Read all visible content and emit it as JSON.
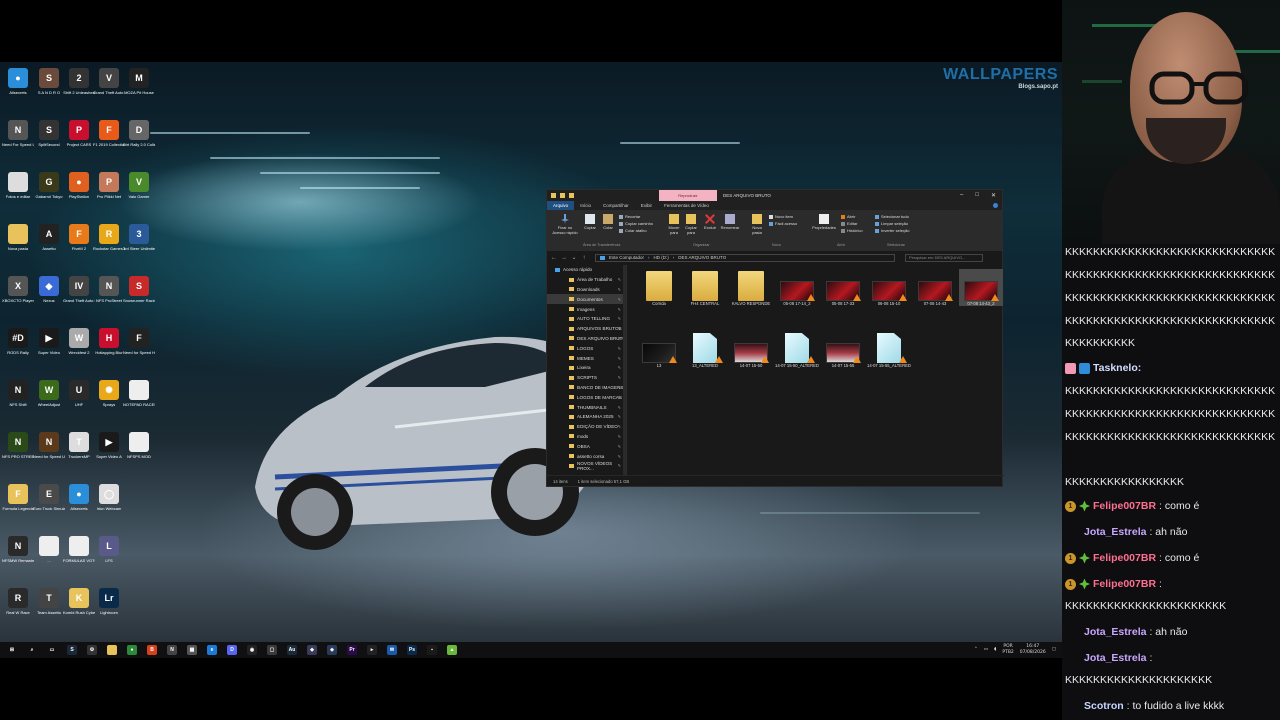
{
  "wallpaper": {
    "brand": "WALLPAPERS",
    "brand_sub": "Blogs.sapo.pt"
  },
  "desktop_icons": [
    {
      "label": "Allsecrets",
      "color": "#2a8fd8",
      "glyph": "●"
    },
    {
      "label": "S A N D R O",
      "color": "#6a4a3a",
      "glyph": "S"
    },
    {
      "label": "Shift 2 Unleashed",
      "color": "#333",
      "glyph": "2"
    },
    {
      "label": "Grand Theft Auto V",
      "color": "#444",
      "glyph": "V"
    },
    {
      "label": "MOZA Pit House",
      "color": "#222",
      "glyph": "M"
    },
    {
      "label": "Need For Speed Unb...",
      "color": "#555",
      "glyph": "N"
    },
    {
      "label": "SplitSecond",
      "color": "#333",
      "glyph": "S"
    },
    {
      "label": "Project CARS",
      "color": "#c8102e",
      "glyph": "P"
    },
    {
      "label": "F1 2019 Collection",
      "color": "#e85a1a",
      "glyph": "F"
    },
    {
      "label": "Dirt Rally 2.0 Collected",
      "color": "#666",
      "glyph": "D"
    },
    {
      "label": "Fotos e editar",
      "color": "#ddd",
      "glyph": ""
    },
    {
      "label": "Gabarrol Tokyo",
      "color": "#3a3a1a",
      "glyph": "G"
    },
    {
      "label": "PlayStation",
      "color": "#e06020",
      "glyph": "●"
    },
    {
      "label": "Pro Pilkki Net",
      "color": "#c47a5a",
      "glyph": "P"
    },
    {
      "label": "Valo Gamer",
      "color": "#4a8a2a",
      "glyph": "V"
    },
    {
      "label": "Nova pasta",
      "color": "#e8c25a",
      "glyph": ""
    },
    {
      "label": "Assetto",
      "color": "#222",
      "glyph": "A"
    },
    {
      "label": "FiveM 2",
      "color": "#e87a1a",
      "glyph": "F"
    },
    {
      "label": "Rockstar Games L...",
      "color": "#e8a81a",
      "glyph": "R"
    },
    {
      "label": "3rd Steer Unlimited 2",
      "color": "#2a5a9a",
      "glyph": "3"
    },
    {
      "label": "XBOXCTO Player",
      "color": "#555",
      "glyph": "X"
    },
    {
      "label": "Nexus",
      "color": "#3a6ad6",
      "glyph": "◆"
    },
    {
      "label": "Grand Theft Auto IV",
      "color": "#444",
      "glyph": "IV"
    },
    {
      "label": "NFS ProStreet",
      "color": "#555",
      "glyph": "N"
    },
    {
      "label": "Snowrunner Racing",
      "color": "#c82a2a",
      "glyph": "S"
    },
    {
      "label": "RODS Rally",
      "color": "#1a1a1a",
      "glyph": "#D"
    },
    {
      "label": "Super Video",
      "color": "#1a1a1a",
      "glyph": "▶"
    },
    {
      "label": "Wreckfest 2",
      "color": "#aaa",
      "glyph": "W"
    },
    {
      "label": "Hotlapping Blur",
      "color": "#c8102e",
      "glyph": "H"
    },
    {
      "label": "Need for Speed Heat",
      "color": "#222",
      "glyph": "F"
    },
    {
      "label": "NFS Shift",
      "color": "#222",
      "glyph": "N"
    },
    {
      "label": "WheelAdjust",
      "color": "#3a6a1a",
      "glyph": "W"
    },
    {
      "label": "UHF",
      "color": "#2a2a2a",
      "glyph": "U"
    },
    {
      "label": "Sprays",
      "color": "#e8a81a",
      "glyph": "✺"
    },
    {
      "label": "NOTEPAD RACES",
      "color": "#eee",
      "glyph": ""
    },
    {
      "label": "NFS PRO STREET",
      "color": "#2a4a1a",
      "glyph": "N"
    },
    {
      "label": "Need for Speed Underground",
      "color": "#5a3a1a",
      "glyph": "N"
    },
    {
      "label": "TruckersMP",
      "color": "#ddd",
      "glyph": "T"
    },
    {
      "label": "Super Video A",
      "color": "#1a1a1a",
      "glyph": "▶"
    },
    {
      "label": "NFSPS MOD",
      "color": "#eee",
      "glyph": ""
    },
    {
      "label": "Formula Legends",
      "color": "#e8c25a",
      "glyph": "F"
    },
    {
      "label": "Euro Truck Simulator 2",
      "color": "#4a4a4a",
      "glyph": "E"
    },
    {
      "label": "Allsecrets",
      "color": "#2a8fd8",
      "glyph": "●"
    },
    {
      "label": "Iriun Webcam",
      "color": "#ddd",
      "glyph": "◯"
    },
    {
      "label": "",
      "color": "#000",
      "glyph": ""
    },
    {
      "label": "NFSMW Remaster",
      "color": "#2a2a2a",
      "glyph": "N"
    },
    {
      "label": "...",
      "color": "#eee",
      "glyph": ""
    },
    {
      "label": "FORMULAS VOTOS LIVE",
      "color": "#eee",
      "glyph": ""
    },
    {
      "label": "LFS",
      "color": "#5a5a8a",
      "glyph": "L"
    },
    {
      "label": "",
      "color": "#000",
      "glyph": ""
    },
    {
      "label": "Real W Race",
      "color": "#2a2a2a",
      "glyph": "R"
    },
    {
      "label": "Team Assetto",
      "color": "#444",
      "glyph": "T"
    },
    {
      "label": "Kombi Rush Cyberfunk",
      "color": "#e8c25a",
      "glyph": "K"
    },
    {
      "label": "Lightroom",
      "color": "#0a2a4a",
      "glyph": "Lr"
    }
  ],
  "explorer": {
    "title": "DES ARQUIVO BRUTO",
    "context_tab": "Reproduzir",
    "tabs": [
      "Arquivo",
      "Início",
      "Compartilhar",
      "Exibir",
      "Ferramentas de Vídeo"
    ],
    "ribbon": {
      "pin": "Fixar no Acesso rápido",
      "copy": "Copiar",
      "paste": "Colar",
      "cut": "Recortar",
      "copy_path": "Copiar caminho",
      "paste_shortcut": "Colar atalho",
      "move_to": "Mover para",
      "copy_to": "Copiar para",
      "delete": "Excluir",
      "rename": "Renomear",
      "new_folder": "Nova pasta",
      "new_item": "Novo item",
      "easy_access": "Fácil acesso",
      "properties": "Propriedades",
      "open": "Abrir",
      "edit": "Editar",
      "history": "Histórico",
      "select_all": "Selecionar tudo",
      "select_none": "Limpar seleção",
      "invert": "Inverter seleção",
      "grp_clipboard": "Área de Transferência",
      "grp_organize": "Organizar",
      "grp_new": "Novo",
      "grp_open": "Abrir",
      "grp_select": "Selecionar"
    },
    "address": [
      "Este Computador",
      "HD (D:)",
      "DES ARQUIVO BRUTO"
    ],
    "search_placeholder": "Pesquisar em DES ARQUIVO...",
    "nav_items": [
      {
        "label": "Acesso rápido",
        "head": true
      },
      {
        "label": "Área de Trabalho"
      },
      {
        "label": "Downloads"
      },
      {
        "label": "Documentos",
        "selected": true
      },
      {
        "label": "Imagens"
      },
      {
        "label": "AUTO TELLING"
      },
      {
        "label": "ARQUIVOS BRUTOS"
      },
      {
        "label": "DES ARQUIVO BRUTO"
      },
      {
        "label": "LOGOS"
      },
      {
        "label": "MEMES"
      },
      {
        "label": "Lixeira"
      },
      {
        "label": "SCRIPTS"
      },
      {
        "label": "BANCO DE IMAGENS"
      },
      {
        "label": "LOGOS DE MARCAS"
      },
      {
        "label": "THUMBNAILS"
      },
      {
        "label": "ALEMANHA 2025"
      },
      {
        "label": "EDIÇÃO DE VÍDEO"
      },
      {
        "label": "mods"
      },
      {
        "label": "OBSA"
      },
      {
        "label": "assetto corsa"
      },
      {
        "label": "NOVOS VÍDEOS PROX..."
      }
    ],
    "files": [
      {
        "name": "Corrida",
        "kind": "folder"
      },
      {
        "name": "FH4 CENTRAL",
        "kind": "folder"
      },
      {
        "name": "KALVO RESPONDE",
        "kind": "folder"
      },
      {
        "name": "05-08 17-14_2",
        "kind": "vid"
      },
      {
        "name": "05-08 17-33",
        "kind": "vid"
      },
      {
        "name": "06-08 15-10",
        "kind": "vid"
      },
      {
        "name": "07-08 14-43",
        "kind": "vid"
      },
      {
        "name": "07-08 14-43_2",
        "kind": "vid",
        "selected": true
      },
      {
        "name": "13",
        "kind": "dark"
      },
      {
        "name": "13_ALTERED",
        "kind": "doc"
      },
      {
        "name": "14-07 15-50",
        "kind": "car"
      },
      {
        "name": "14-07 15-50_ALTERED",
        "kind": "doc"
      },
      {
        "name": "14-07 15-55",
        "kind": "car"
      },
      {
        "name": "14-07 15-55_ALTERED",
        "kind": "doc"
      }
    ],
    "status": {
      "count": "14 itens",
      "selection": "1 item selecionado  57,1 GB"
    }
  },
  "taskbar": {
    "apps": [
      {
        "name": "windows",
        "glyph": "⊞",
        "color": "#101012"
      },
      {
        "name": "search",
        "glyph": "⌕",
        "color": "#101012"
      },
      {
        "name": "task-view",
        "glyph": "▭",
        "color": "#101012"
      },
      {
        "name": "steam",
        "glyph": "S",
        "color": "#1b2838"
      },
      {
        "name": "settings",
        "glyph": "⚙",
        "color": "#333"
      },
      {
        "name": "explorer",
        "glyph": "",
        "color": "#e8c25a"
      },
      {
        "name": "chrome",
        "glyph": "●",
        "color": "#2a8a3a"
      },
      {
        "name": "brave",
        "glyph": "B",
        "color": "#d6401a"
      },
      {
        "name": "notepad",
        "glyph": "N",
        "color": "#444"
      },
      {
        "name": "calculator",
        "glyph": "▦",
        "color": "#555"
      },
      {
        "name": "edge",
        "glyph": "e",
        "color": "#1a7ad6"
      },
      {
        "name": "discord",
        "glyph": "D",
        "color": "#5865f2"
      },
      {
        "name": "obs",
        "glyph": "◉",
        "color": "#222"
      },
      {
        "name": "files",
        "glyph": "▢",
        "color": "#3a3a3a"
      },
      {
        "name": "audition",
        "glyph": "Au",
        "color": "#1a2a3a"
      },
      {
        "name": "app",
        "glyph": "◆",
        "color": "#3a3a5a"
      },
      {
        "name": "vpn",
        "glyph": "◈",
        "color": "#2a3a5a"
      },
      {
        "name": "premiere",
        "glyph": "Pr",
        "color": "#2a0a4a"
      },
      {
        "name": "gamebar",
        "glyph": "▸",
        "color": "#222"
      },
      {
        "name": "mail",
        "glyph": "✉",
        "color": "#1a5aaa"
      },
      {
        "name": "photoshop",
        "glyph": "Ps",
        "color": "#0a2a4a"
      },
      {
        "name": "app2",
        "glyph": "▪",
        "color": "#1a1a1a"
      },
      {
        "name": "android",
        "glyph": "▲",
        "color": "#6ab83a"
      }
    ],
    "lang": "POR",
    "kbd": "PTB2",
    "time": "16:47",
    "date": "07/08/2026"
  },
  "chat": {
    "messages": [
      {
        "text": "KKKKKKKKKKKKKKKKKKKKKKKKKKKKKK",
        "user": "",
        "ucolor": ""
      },
      {
        "text": "KKKKKKKKKKKKKKKKKKKKKKKKKKKKKK",
        "user": "",
        "ucolor": ""
      },
      {
        "text": "KKKKKKKKKKKKKKKKKKKKKKKKKKKKKK",
        "user": "",
        "ucolor": ""
      },
      {
        "text": "KKKKKKKKKKKKKKKKKKKKKKKKKKKKKK",
        "user": "",
        "ucolor": ""
      },
      {
        "text": "KKKKKKKKKK",
        "user": "",
        "ucolor": ""
      },
      {
        "user": "Tasknelo:",
        "ucolor": "#d6dcff",
        "text": "",
        "badges": [
          "gift",
          "tool"
        ]
      },
      {
        "text": "KKKKKKKKKKKKKKKKKKKKKKKKKKKKKK",
        "user": "",
        "ucolor": ""
      },
      {
        "text": "KKKKKKKKKKKKKKKKKKKKKKKKKKKKKK",
        "user": "",
        "ucolor": ""
      },
      {
        "text": "KKKKKKKKKKKKKKKKKKKKKKKKKKKKKK",
        "user": "",
        "ucolor": ""
      },
      {
        "text": "KKKKKKKKKKKKKKKKK",
        "user": "",
        "ucolor": ""
      },
      {
        "user": "Felipe007BR",
        "ucolor": "#ff6f8f",
        "text": ": como é",
        "badges": [
          "sub",
          "gem"
        ]
      },
      {
        "user": "Jota_Estrela",
        "ucolor": "#c8a6ff",
        "text": ": ah não",
        "badges": []
      },
      {
        "user": "Felipe007BR",
        "ucolor": "#ff6f8f",
        "text": ": como é",
        "badges": [
          "sub",
          "gem"
        ]
      },
      {
        "user": "Felipe007BR",
        "ucolor": "#ff6f8f",
        "text": ":",
        "badges": [
          "sub",
          "gem"
        ]
      },
      {
        "text": "KKKKKKKKKKKKKKKKKKKKKKK",
        "user": "",
        "ucolor": ""
      },
      {
        "user": "Jota_Estrela",
        "ucolor": "#c8a6ff",
        "text": ": ah não",
        "badges": []
      },
      {
        "user": "Jota_Estrela",
        "ucolor": "#c8a6ff",
        "text": ":",
        "badges": []
      },
      {
        "text": "KKKKKKKKKKKKKKKKKKKKK",
        "user": "",
        "ucolor": ""
      },
      {
        "user": "Scotron",
        "ucolor": "#c8d6ff",
        "text": ": to fudido a live kkkk",
        "badges": []
      }
    ],
    "sub_badge_label": "1"
  }
}
